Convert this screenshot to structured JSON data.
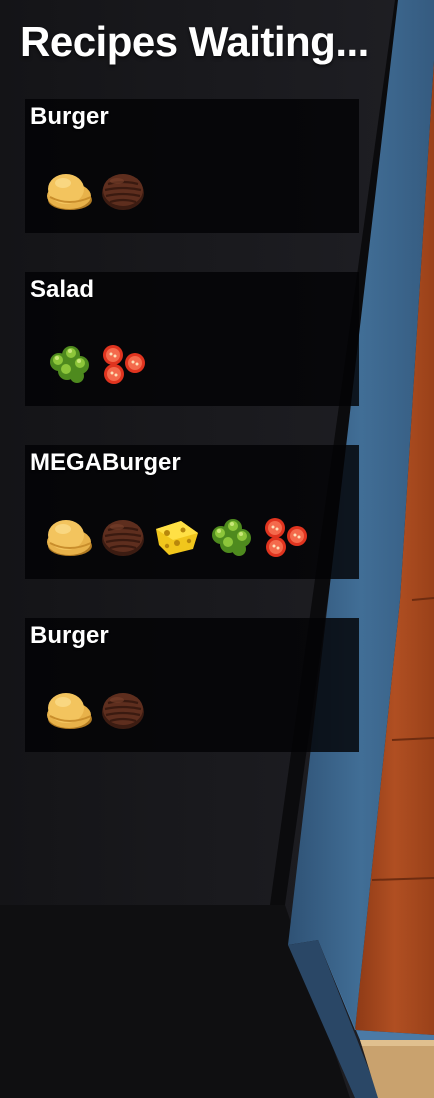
{
  "hud": {
    "title": "Recipes Waiting..."
  },
  "recipes": [
    {
      "name": "Burger",
      "ingredients": [
        "bun-icon",
        "meat-patty-icon"
      ]
    },
    {
      "name": "Salad",
      "ingredients": [
        "lettuce-icon",
        "tomato-slices-icon"
      ]
    },
    {
      "name": "MEGABurger",
      "ingredients": [
        "bun-icon",
        "meat-patty-icon",
        "cheese-slice-icon",
        "lettuce-icon",
        "tomato-slices-icon"
      ]
    },
    {
      "name": "Burger",
      "ingredients": [
        "bun-icon",
        "meat-patty-icon"
      ]
    }
  ],
  "colors": {
    "panel_bg": "#030305",
    "wall_dark": "#1a1a1e",
    "counter_blue": "#3f6a91",
    "counter_wood": "#a84a20"
  }
}
